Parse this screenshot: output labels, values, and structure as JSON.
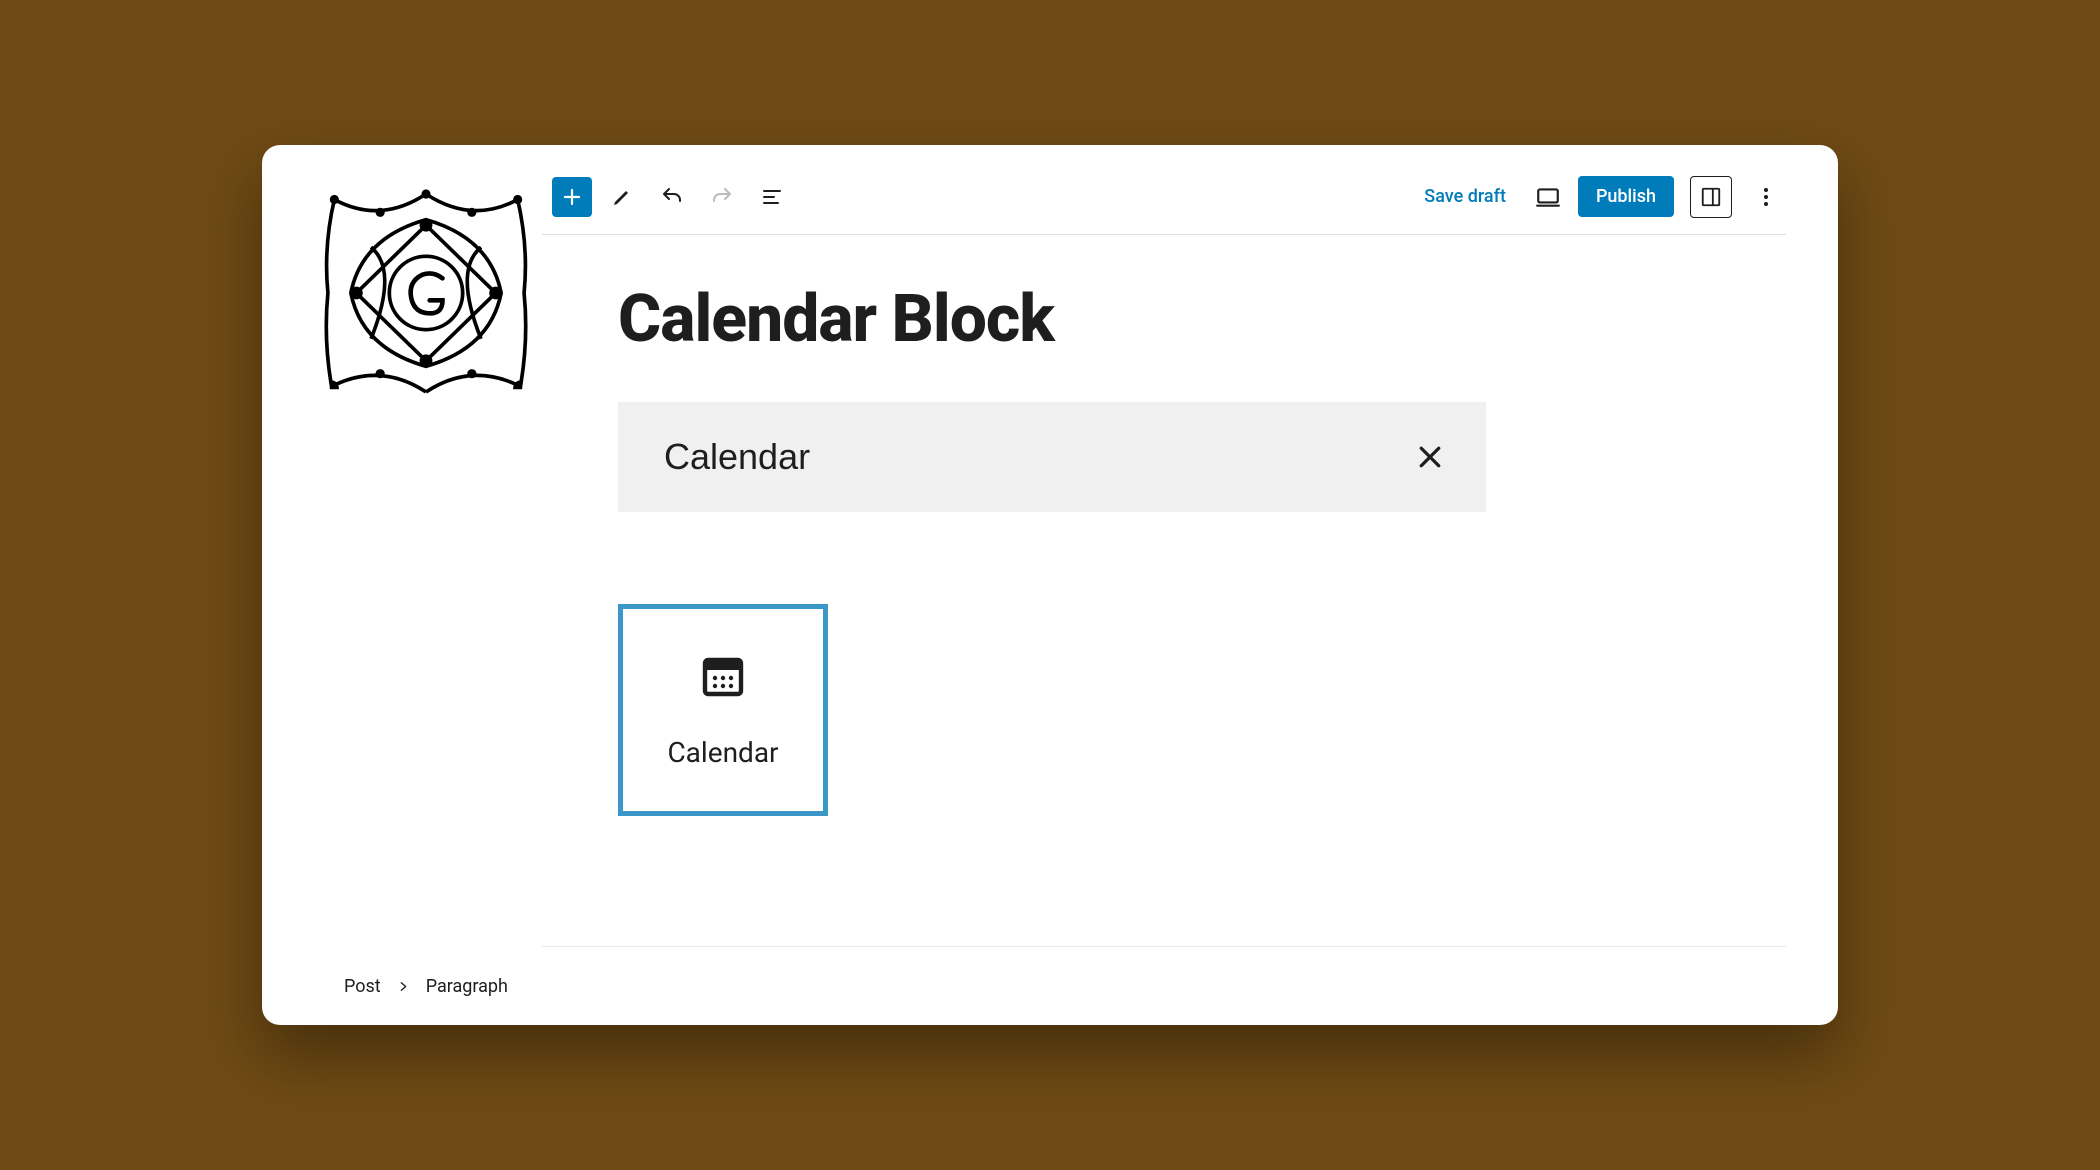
{
  "toolbar": {
    "save_draft": "Save draft",
    "publish": "Publish"
  },
  "page": {
    "title": "Calendar Block"
  },
  "search": {
    "value": "Calendar"
  },
  "result": {
    "label": "Calendar"
  },
  "breadcrumb": {
    "root": "Post",
    "current": "Paragraph"
  }
}
